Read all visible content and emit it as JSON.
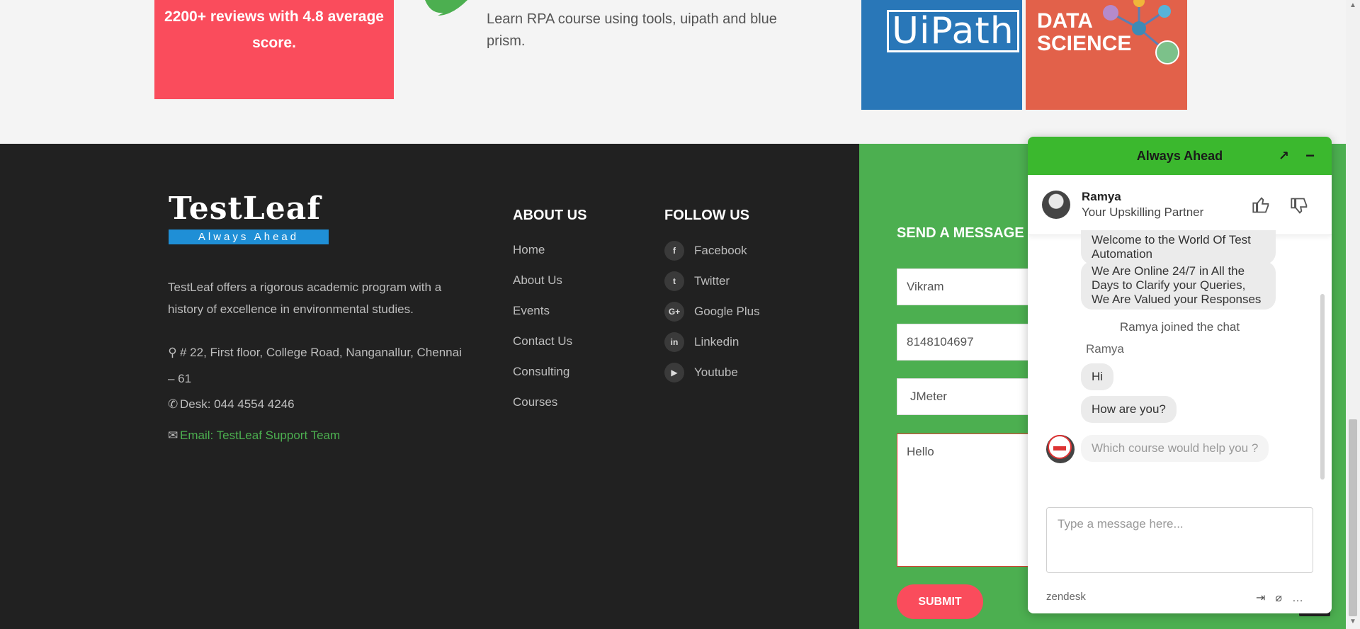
{
  "hero": {
    "reviews": "2200+ reviews with 4.8 average score.",
    "rpa_text": "Learn RPA course using tools, uipath and blue prism.",
    "uipath_logo": "UiPath",
    "data_science_line1": "DATA",
    "data_science_line2": "SCIENCE"
  },
  "footer": {
    "logo_word": "TestLeaf",
    "logo_tagline": "Always Ahead",
    "description": "TestLeaf offers a rigorous academic program with a history of excellence in environmental studies.",
    "address": "# 22, First floor, College Road, Nanganallur, Chennai – 61",
    "phone": "Desk: 044 4554 4246",
    "email": "Email: TestLeaf Support Team",
    "about_title": "ABOUT US",
    "about_links": [
      "Home",
      "About Us",
      "Events",
      "Contact Us",
      "Consulting",
      "Courses"
    ],
    "follow_title": "FOLLOW US",
    "social": [
      {
        "label": "Facebook",
        "glyph": "f",
        "icon": "facebook-icon"
      },
      {
        "label": "Twitter",
        "glyph": "t",
        "icon": "twitter-icon"
      },
      {
        "label": "Google Plus",
        "glyph": "G+",
        "icon": "google-plus-icon"
      },
      {
        "label": "Linkedin",
        "glyph": "in",
        "icon": "linkedin-icon"
      },
      {
        "label": "Youtube",
        "glyph": "▶",
        "icon": "youtube-icon"
      }
    ]
  },
  "form": {
    "title": "SEND A MESSAGE",
    "name_value": "Vikram",
    "phone_value": "8148104697",
    "course_value": "JMeter",
    "message_value": "Hello",
    "submit_label": "SUBMIT"
  },
  "chat": {
    "title": "Always Ahead",
    "agent_name": "Ramya",
    "agent_role": "Your Upskilling Partner",
    "msg_welcome": "Welcome to the World Of Test Automation",
    "msg_online": "We Are Online 24/7 in All the Days to Clarify your Queries, We Are Valued your Responses",
    "joined": "Ramya joined the chat",
    "sender": "Ramya",
    "msg_hi": "Hi",
    "msg_how": "How are you?",
    "msg_course": "Which course would help you ?",
    "input_placeholder": "Type a message here...",
    "brand": "zendesk"
  },
  "colors": {
    "accent_red": "#fa4c5c",
    "footer_dark": "#212121",
    "form_green": "#4caf50",
    "chat_header_green": "#3bb82e"
  }
}
